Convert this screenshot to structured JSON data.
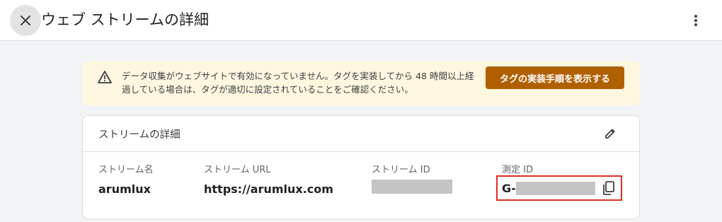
{
  "header": {
    "title": "ウェブ ストリームの詳細",
    "close_icon": "close-icon",
    "more_icon": "more-vert-icon"
  },
  "banner": {
    "icon": "warning-icon",
    "text": "データ収集がウェブサイトで有効になっていません。タグを実装してから 48 時間以上経過している場合は、タグが適切に設定されていることをご確認ください。",
    "button_label": "タグの実装手順を表示する",
    "background": "#fef7e0",
    "button_color": "#b06000"
  },
  "stream_details": {
    "title": "ストリームの詳細",
    "edit_icon": "edit-pencil-icon",
    "fields": {
      "stream_name": {
        "label": "ストリーム名",
        "value": "arumlux"
      },
      "stream_url": {
        "label": "ストリーム URL",
        "value": "https://arumlux.com"
      },
      "stream_id": {
        "label": "ストリーム ID"
      },
      "measurement_id": {
        "label": "測定 ID",
        "value_prefix": "G-"
      }
    },
    "copy_icon": "copy-icon",
    "highlight_color": "#d93025"
  }
}
